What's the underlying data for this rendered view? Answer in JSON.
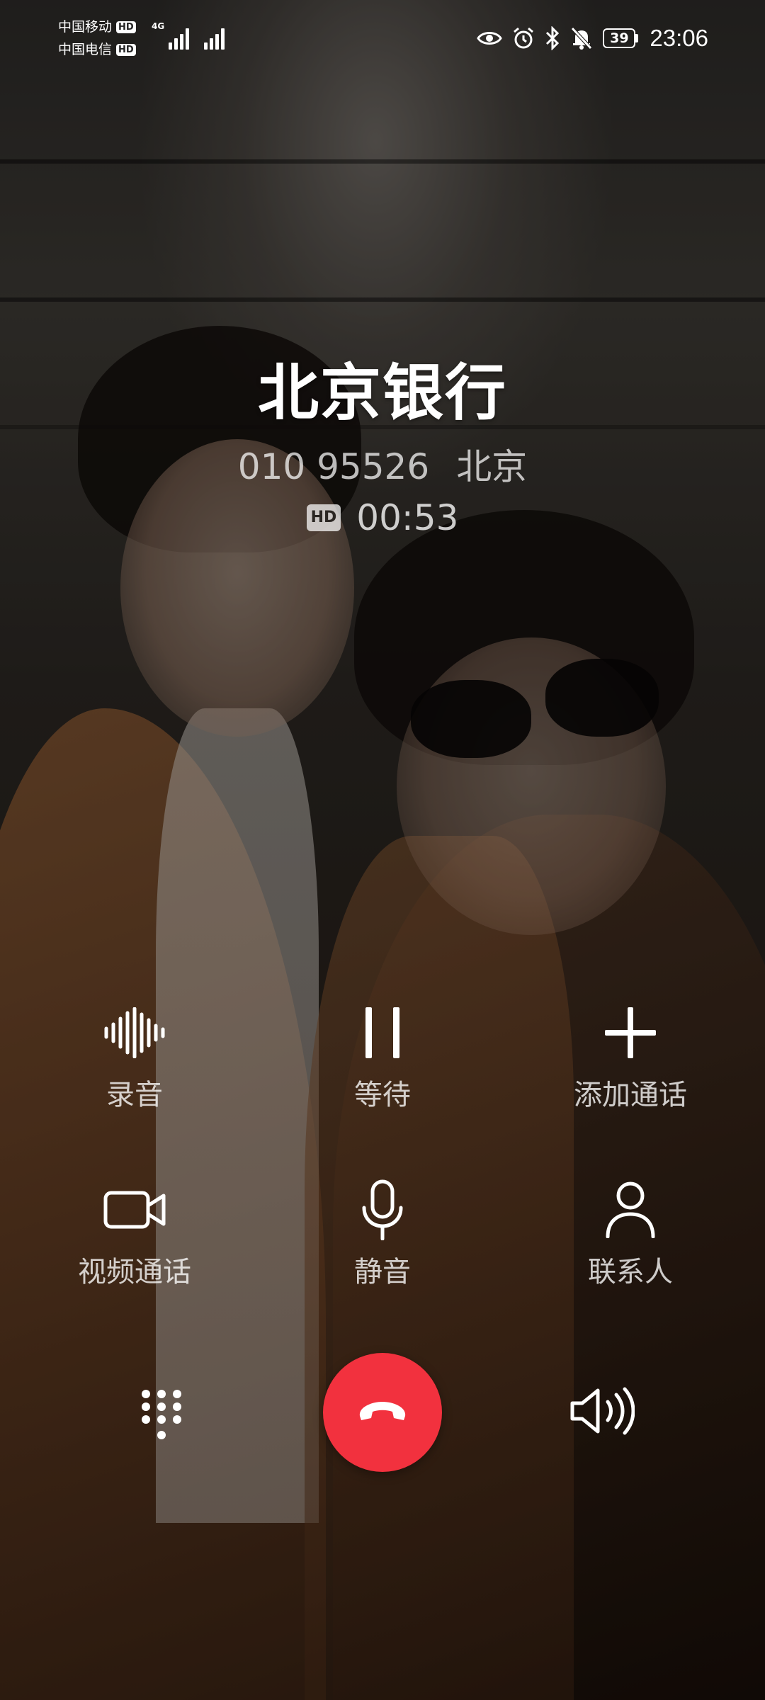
{
  "status_bar": {
    "carriers": [
      {
        "name": "中国移动",
        "badge": "HD",
        "tech": "4G"
      },
      {
        "name": "中国电信",
        "badge": "HD",
        "tech": ""
      }
    ],
    "icons": [
      "eye-icon",
      "alarm-icon",
      "bluetooth-icon",
      "mute-bell-icon"
    ],
    "battery": "39",
    "time": "23:06"
  },
  "caller": {
    "name": "北京银行",
    "number": "010 95526",
    "location": "北京",
    "hd_badge": "HD",
    "duration": "00:53"
  },
  "controls": [
    {
      "label": "录音",
      "icon": "record-waveform-icon"
    },
    {
      "label": "等待",
      "icon": "pause-icon"
    },
    {
      "label": "添加通话",
      "icon": "plus-icon"
    },
    {
      "label": "视频通话",
      "icon": "video-camera-icon"
    },
    {
      "label": "静音",
      "icon": "microphone-icon"
    },
    {
      "label": "联系人",
      "icon": "person-icon"
    }
  ],
  "bottom": {
    "keypad_icon": "dialpad-icon",
    "hangup_icon": "hangup-phone-icon",
    "hangup_color": "#f2313e",
    "speaker_icon": "speaker-icon"
  }
}
